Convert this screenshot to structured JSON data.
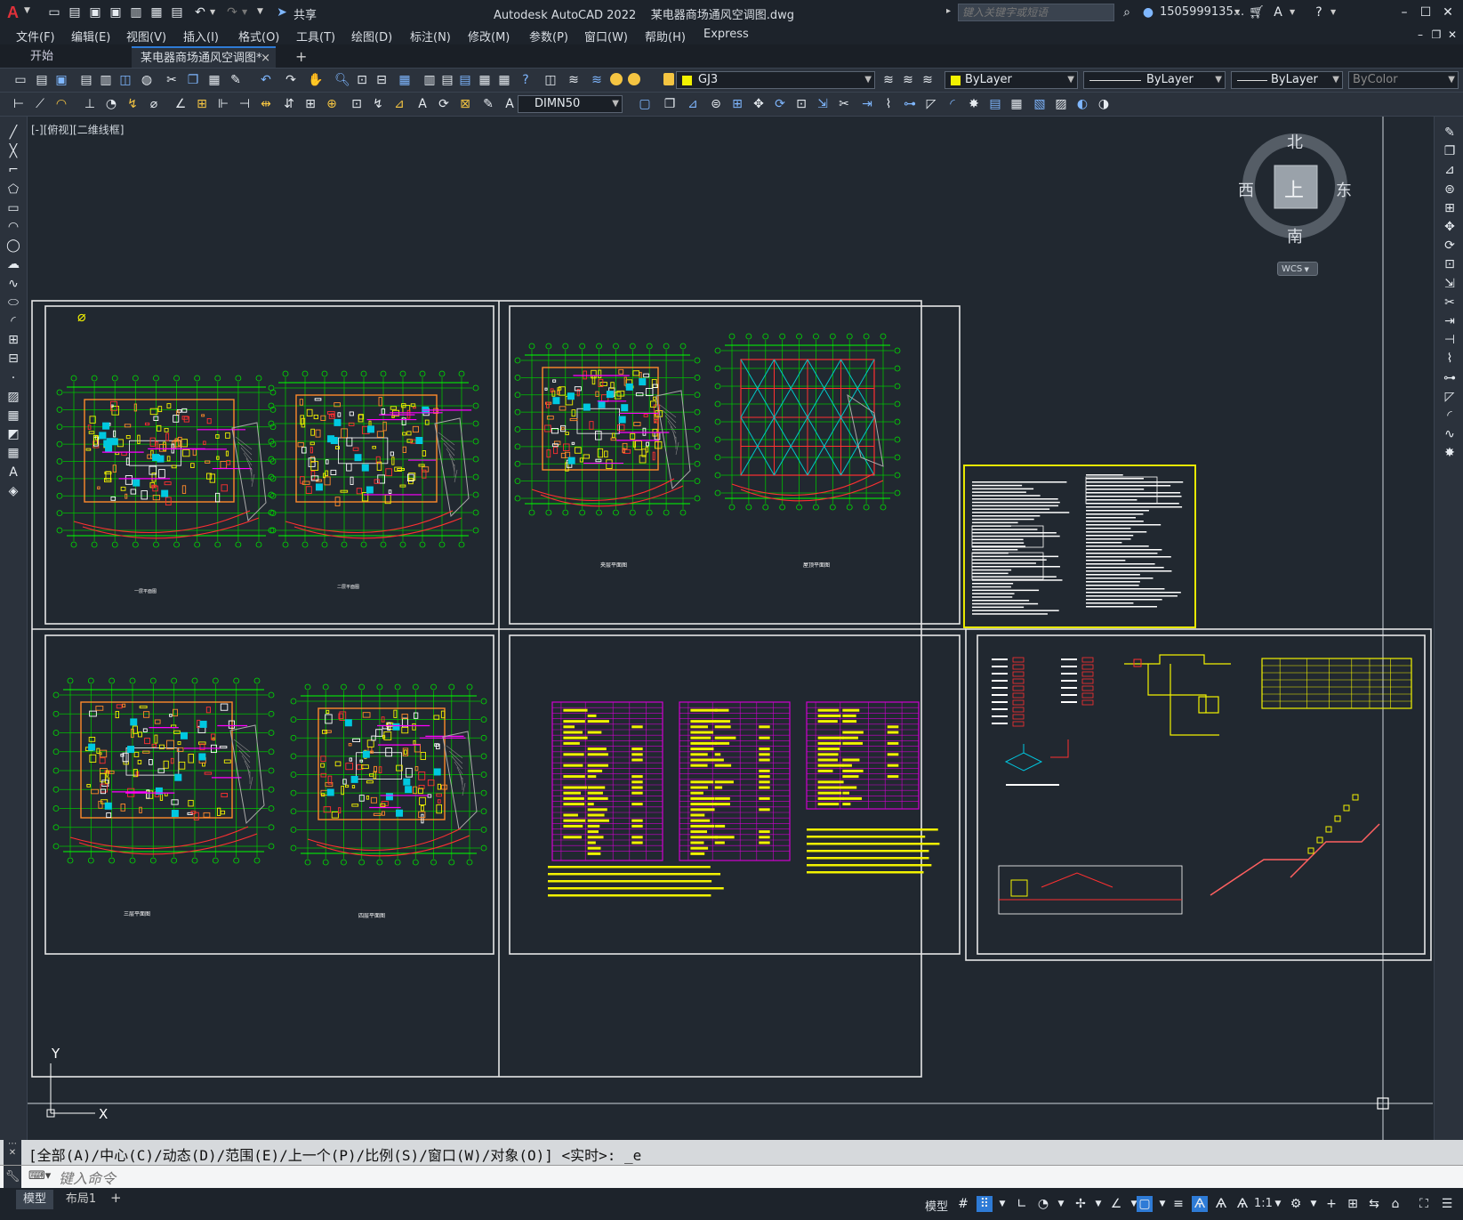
{
  "app": {
    "title": "Autodesk AutoCAD 2022",
    "filename": "某电器商场通风空调图.dwg",
    "share": "共享",
    "search_placeholder": "键入关键字或短语",
    "user": "1505999135..."
  },
  "menu": [
    "文件(F)",
    "编辑(E)",
    "视图(V)",
    "插入(I)",
    "格式(O)",
    "工具(T)",
    "绘图(D)",
    "标注(N)",
    "修改(M)",
    "参数(P)",
    "窗口(W)",
    "帮助(H)",
    "Express"
  ],
  "tabs": {
    "start": "开始",
    "active": "某电器商场通风空调图*",
    "close": "×",
    "add": "+"
  },
  "toolbar": {
    "layer": "GJ3",
    "color": "ByLayer",
    "linetype": "ByLayer",
    "lineweight": "ByLayer",
    "plotstyle": "ByColor",
    "dimstyle": "DIMN50"
  },
  "viewport": {
    "label": "[-][俯视][二维线框]"
  },
  "viewcube": {
    "north": "北",
    "south": "南",
    "east": "东",
    "west": "西",
    "top": "上",
    "wcs": "WCS"
  },
  "ucs": {
    "x": "X",
    "y": "Y"
  },
  "drawing_labels": {
    "p1a": "一层平面图",
    "p1b": "二层平面图",
    "p2a": "夹层平面图",
    "p2b": "屋顶平面图",
    "p3a": "三层平面图",
    "p3b": "四层平面图"
  },
  "command": {
    "history": "[全部(A)/中心(C)/动态(D)/范围(E)/上一个(P)/比例(S)/窗口(W)/对象(O)] <实时>: _e",
    "placeholder": "键入命令"
  },
  "layout_tabs": [
    "模型",
    "布局1"
  ],
  "status": {
    "model": "模型",
    "scale": "1:1"
  },
  "colors": {
    "accent": "#2e7bd6",
    "layer_yellow": "#f2f200"
  }
}
